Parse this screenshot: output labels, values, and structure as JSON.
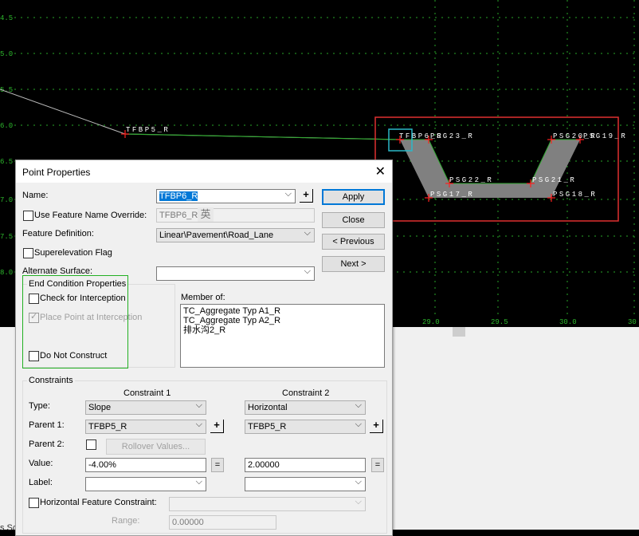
{
  "cad_view": {
    "y_labels": [
      "4.5",
      "5.0",
      "5.5",
      "6.0",
      "6.5",
      "7.0",
      "7.5",
      "8.0"
    ],
    "x_labels": [
      "29.0",
      "29.5",
      "30.0",
      "30"
    ],
    "point_labels": [
      "TFBP5_R",
      "TFBP6_R",
      "PSG23_R",
      "PSG20_R",
      "PSG19_R",
      "PSG22_R",
      "PSG21_R",
      "PSG17_R",
      "PSG18_R"
    ],
    "colors": {
      "background": "#000000",
      "grid": "#2db82d",
      "line": "#33a833",
      "marker": "#ff2020",
      "fill": "#808080",
      "highlight_red": "#e03030",
      "highlight_cyan": "#2ab8c8"
    }
  },
  "dialog": {
    "title": "Point Properties",
    "name_label": "Name:",
    "name_value": "TFBP6_R",
    "use_feature_override_label": "Use Feature Name Override:",
    "override_value": "TFBP6_R",
    "ime_char": "英",
    "feature_definition_label": "Feature Definition:",
    "feature_definition_value": "Linear\\Pavement\\Road_Lane",
    "superelevation_label": "Superelevation Flag",
    "alternate_surface_label": "Alternate Surface:",
    "alternate_surface_value": "",
    "buttons": {
      "apply": "Apply",
      "close": "Close",
      "previous": "< Previous",
      "next": "Next >"
    },
    "end_condition": {
      "title": "End Condition Properties",
      "check_interception": "Check for Interception",
      "place_point": "Place Point at Interception",
      "do_not_construct": "Do Not Construct"
    },
    "member_of": {
      "label": "Member of:",
      "items": [
        "TC_Aggregate Typ A1_R",
        "TC_Aggregate Typ A2_R",
        "排水沟2_R"
      ]
    },
    "constraints": {
      "title": "Constraints",
      "col1_header": "Constraint 1",
      "col2_header": "Constraint 2",
      "type_label": "Type:",
      "type1": "Slope",
      "type2": "Horizontal",
      "parent1_label": "Parent 1:",
      "parent1_c1": "TFBP5_R",
      "parent1_c2": "TFBP5_R",
      "parent2_label": "Parent 2:",
      "rollover_label": "Rollover Values...",
      "value_label": "Value:",
      "value1": "-4.00%",
      "value2": "2.00000",
      "eq_button": "=",
      "label_label": "Label:",
      "label1": "",
      "label2": "",
      "horizontal_feature_label": "Horizontal Feature Constraint:",
      "horizontal_feature_value": "",
      "range_label": "Range:",
      "range_value": "0.00000"
    }
  },
  "background_text": {
    "cutoff": "s Sc"
  }
}
